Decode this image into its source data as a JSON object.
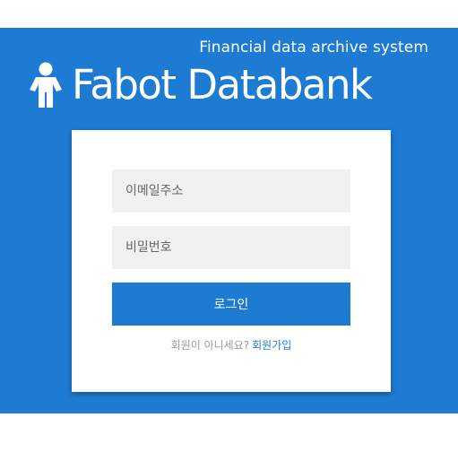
{
  "header": {
    "tagline": "Financial data archive system",
    "brand_name": "Fabot Databank",
    "brand_icon": "person-icon"
  },
  "login_form": {
    "email_placeholder": "이메일주소",
    "password_placeholder": "비밀번호",
    "login_label": "로그인",
    "signup_prompt": "회원이 아니세요?",
    "signup_link": "회원가입"
  },
  "colors": {
    "brand_blue": "#1e7bd3",
    "input_background": "#f1f1f1",
    "page_background": "#ffffff"
  }
}
